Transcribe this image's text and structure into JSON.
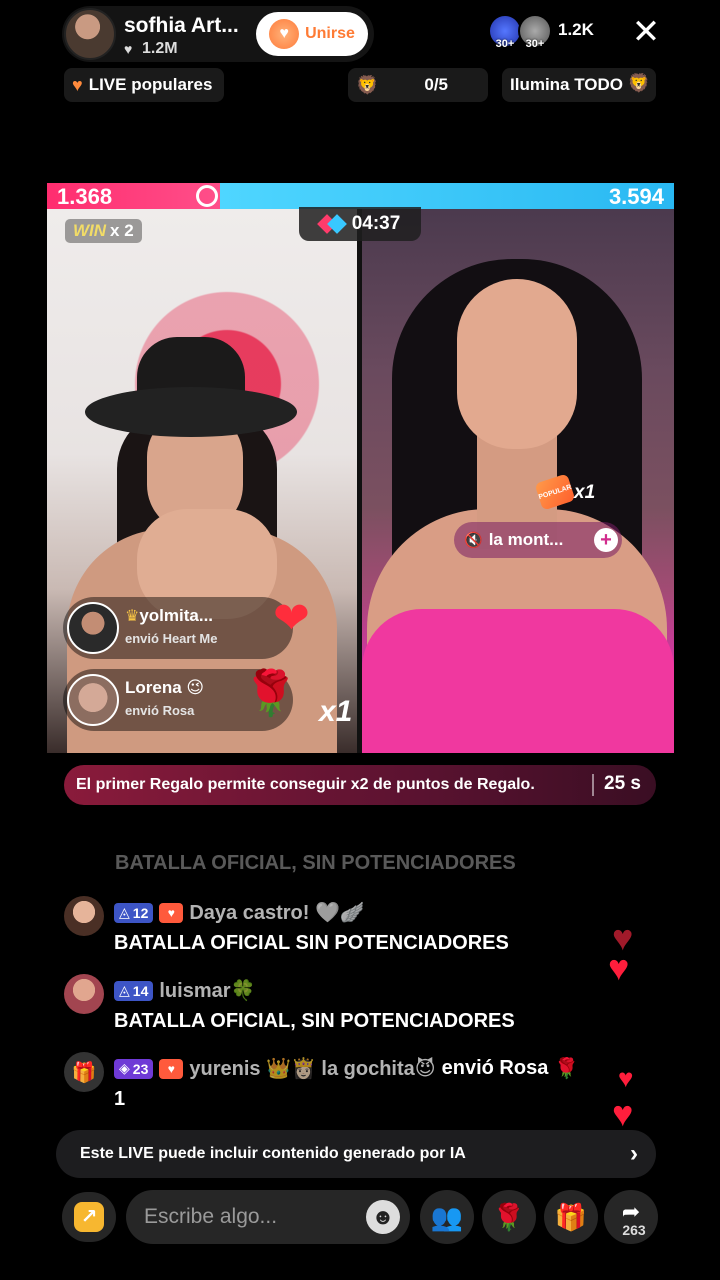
{
  "host": {
    "name": "sofhia Art...",
    "likes": "1.2M",
    "join_label": "Unirse"
  },
  "viewers": {
    "count": "1.2K",
    "badges": [
      "30+",
      "30+"
    ]
  },
  "pills": {
    "live_popular": "LIVE populares",
    "goal": "0/5",
    "ilumina": "Ilumina TODO"
  },
  "battle": {
    "score_left": "1.368",
    "score_right": "3.594",
    "score_left_fraction": 0.276,
    "win_label": "WIN",
    "win_multiplier": "x 2",
    "timer": "04:37",
    "left_multiplier": "x1",
    "right_multiplier": "x1",
    "popular_tag": "POPULAR",
    "muted_user": "la mont...",
    "gifts": [
      {
        "user": "yolmita...",
        "desc": "envió Heart Me",
        "emoji": "❤"
      },
      {
        "user": "Lorena 😉",
        "desc": "envió Rosa",
        "emoji": "🌹"
      }
    ]
  },
  "promo": {
    "text": "El primer Regalo permite conseguir x2 de puntos de Regalo.",
    "time": "25 s"
  },
  "chat": {
    "ghost": "BATALLA OFICIAL, SIN POTENCIADORES",
    "messages": [
      {
        "level": "12",
        "user": "Daya castro! 🤍🪽",
        "text": "BATALLA OFICIAL SIN POTENCIADORES"
      },
      {
        "level": "14",
        "user": "luismar🍀",
        "text": "BATALLA OFICIAL, SIN POTENCIADORES"
      }
    ],
    "gift_event": {
      "level": "23",
      "users": "yurenis 👑👸🏻 la gochita😈",
      "action": "envió Rosa",
      "count": "1"
    }
  },
  "ai_notice": "Este LIVE puede incluir contenido generado por IA",
  "bottom": {
    "placeholder": "Escribe algo...",
    "share_count": "263"
  },
  "colors": {
    "battle_left": "#ff2d6f",
    "battle_right": "#38c8ff",
    "accent_orange": "#fe7b35"
  }
}
